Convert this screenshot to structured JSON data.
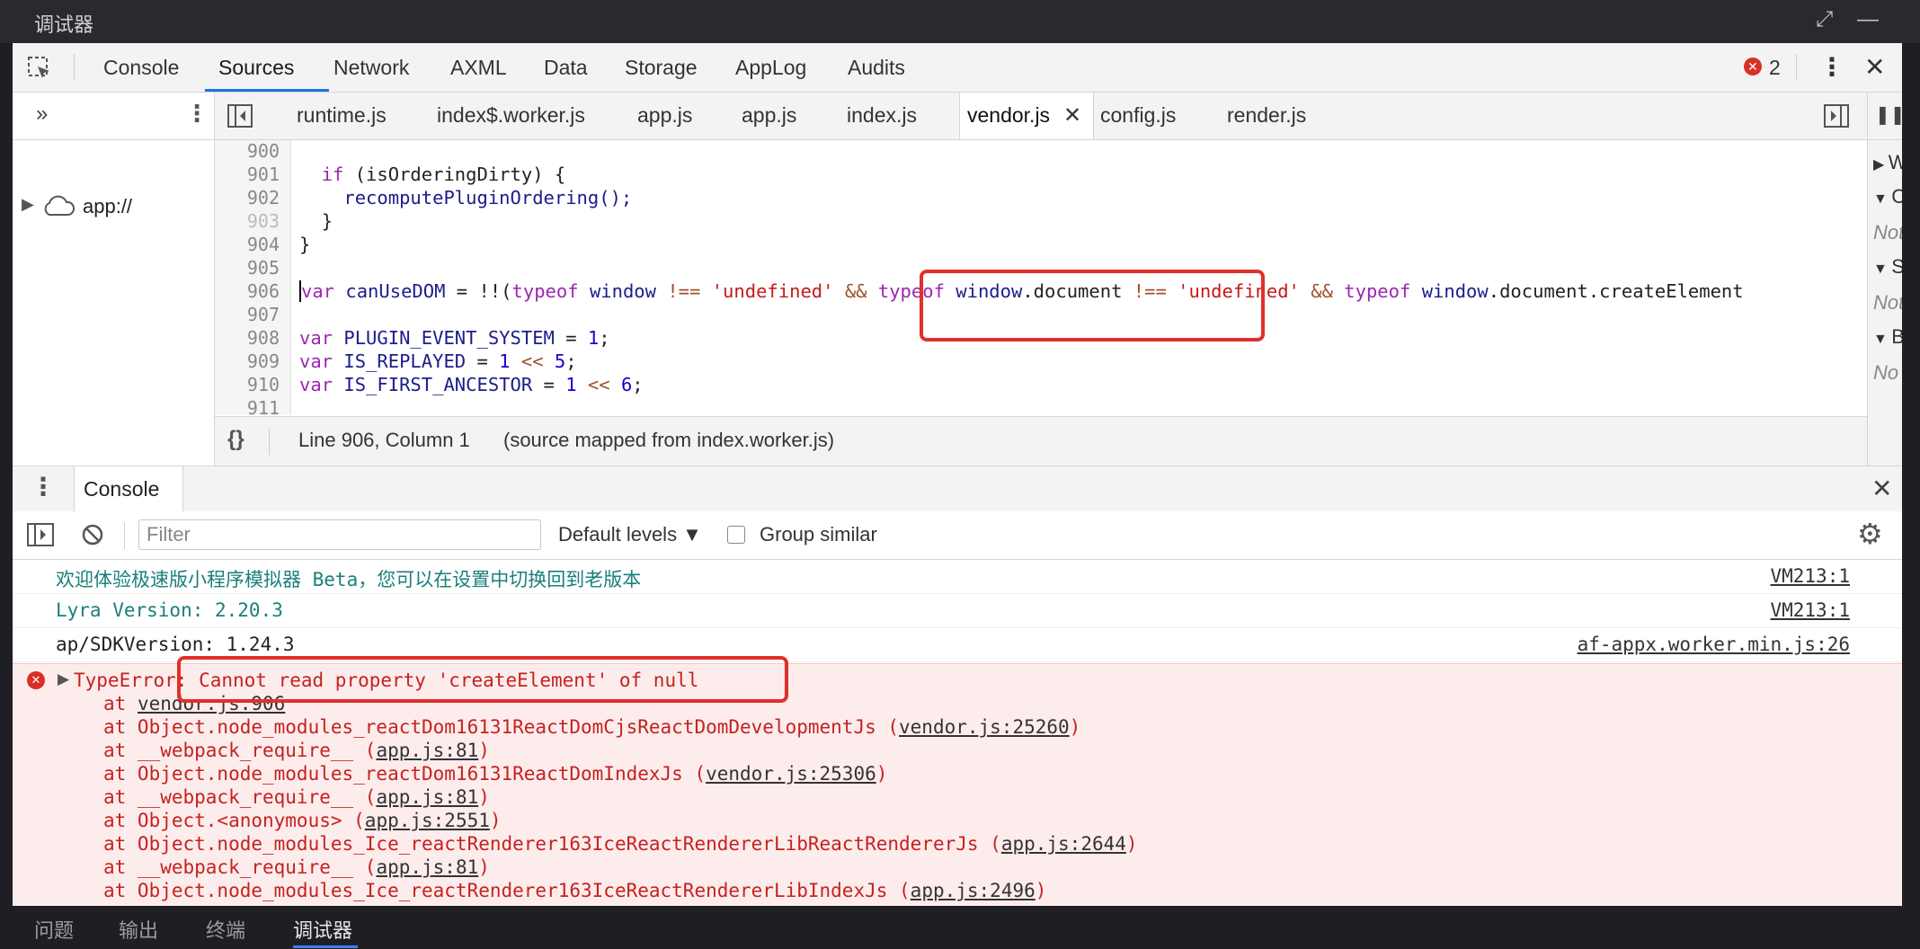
{
  "window": {
    "title": "调试器"
  },
  "main_tabs": [
    {
      "label": "Console"
    },
    {
      "label": "Sources"
    },
    {
      "label": "Network"
    },
    {
      "label": "AXML"
    },
    {
      "label": "Data"
    },
    {
      "label": "Storage"
    },
    {
      "label": "AppLog"
    },
    {
      "label": "Audits"
    }
  ],
  "active_main_tab": "Sources",
  "error_count": "2",
  "navigator": {
    "root_label": "app://"
  },
  "file_tabs": [
    {
      "label": "runtime.js"
    },
    {
      "label": "index$.worker.js"
    },
    {
      "label": "app.js"
    },
    {
      "label": "app.js"
    },
    {
      "label": "index.js"
    },
    {
      "label": "vendor.js"
    },
    {
      "label": "config.js"
    },
    {
      "label": "render.js"
    }
  ],
  "active_file": "vendor.js",
  "code": {
    "line_numbers": [
      "900",
      "901",
      "902",
      "903",
      "904",
      "905",
      "906",
      "907",
      "908",
      "909",
      "910",
      "911"
    ],
    "lines": {
      "l901": {
        "kw": "if",
        "rest": " (isOrderingDirty) {"
      },
      "l902": "recomputePluginOrdering();",
      "l903": "}",
      "l904": "}",
      "l906": {
        "var": "var",
        "name": "canUseDOM",
        "eq": " = !!(",
        "typeof1": "typeof",
        "window1": "window",
        "neq1": " !== ",
        "undef1": "'undefined'",
        "and1": " && ",
        "typeof2": "typeof",
        "window2": "window",
        "doc2": ".document",
        "neq2": " !== ",
        "undef2": "'undefined'",
        "and2": " && ",
        "typeof3": "typeof",
        "window3": "window",
        "rest3": ".document.createElement"
      },
      "l908": {
        "var": "var",
        "name": "PLUGIN_EVENT_SYSTEM",
        "eq": " = ",
        "val": "1",
        "end": ";"
      },
      "l909": {
        "var": "var",
        "name": "IS_REPLAYED",
        "eq": " = ",
        "val": "1",
        "op": " << ",
        "val2": "5",
        "end": ";"
      },
      "l910": {
        "var": "var",
        "name": "IS_FIRST_ANCESTOR",
        "eq": " = ",
        "val": "1",
        "op": " << ",
        "val2": "6",
        "end": ";"
      }
    }
  },
  "status": {
    "position": "Line 906, Column 1",
    "source_map": "(source mapped from index.worker.js)",
    "format_icon": "{}"
  },
  "right_panel": [
    {
      "label": "W"
    },
    {
      "label": "C"
    },
    {
      "label": "Not"
    },
    {
      "label": "Sc"
    },
    {
      "label": "Not"
    },
    {
      "label": "B"
    },
    {
      "label": "No"
    }
  ],
  "drawer": {
    "tab": "Console"
  },
  "console_toolbar": {
    "filter_placeholder": "Filter",
    "levels": "Default levels ▼",
    "group_similar": "Group similar"
  },
  "messages": [
    {
      "text": "欢迎体验极速版小程序模拟器 Beta，您可以在设置中切换回到老版本",
      "source": "VM213:1",
      "color": "#1a7f7a"
    },
    {
      "text": "Lyra Version: 2.20.3",
      "source": "VM213:1",
      "color": "#1a7f7a"
    },
    {
      "text": "ap/SDKVersion: 1.24.3",
      "source": "af-appx.worker.min.js:26",
      "color": "#222222"
    }
  ],
  "error": {
    "head_prefix": "TypeError",
    "head_rest": ": Cannot read property 'createElement' of null",
    "stack": [
      {
        "pre": "at ",
        "link": "vendor.js:906",
        "post": ""
      },
      {
        "pre": "at Object.node_modules_reactDom16131ReactDomCjsReactDomDevelopmentJs (",
        "link": "vendor.js:25260",
        "post": ")"
      },
      {
        "pre": "at __webpack_require__ (",
        "link": "app.js:81",
        "post": ")"
      },
      {
        "pre": "at Object.node_modules_reactDom16131ReactDomIndexJs (",
        "link": "vendor.js:25306",
        "post": ")"
      },
      {
        "pre": "at __webpack_require__ (",
        "link": "app.js:81",
        "post": ")"
      },
      {
        "pre": "at Object.<anonymous> (",
        "link": "app.js:2551",
        "post": ")"
      },
      {
        "pre": "at Object.node_modules_Ice_reactRenderer163IceReactRendererLibReactRendererJs (",
        "link": "app.js:2644",
        "post": ")"
      },
      {
        "pre": "at __webpack_require__ (",
        "link": "app.js:81",
        "post": ")"
      },
      {
        "pre": "at Object.node_modules_Ice_reactRenderer163IceReactRendererLibIndexJs (",
        "link": "app.js:2496",
        "post": ")"
      }
    ]
  },
  "bottom_tabs": [
    {
      "label": "问题"
    },
    {
      "label": "输出"
    },
    {
      "label": "终端"
    },
    {
      "label": "调试器"
    }
  ],
  "active_bottom_tab": "调试器",
  "colors": {
    "accent": "#1a73e8",
    "error": "#d93025",
    "highlight_box": "#e0302a"
  }
}
